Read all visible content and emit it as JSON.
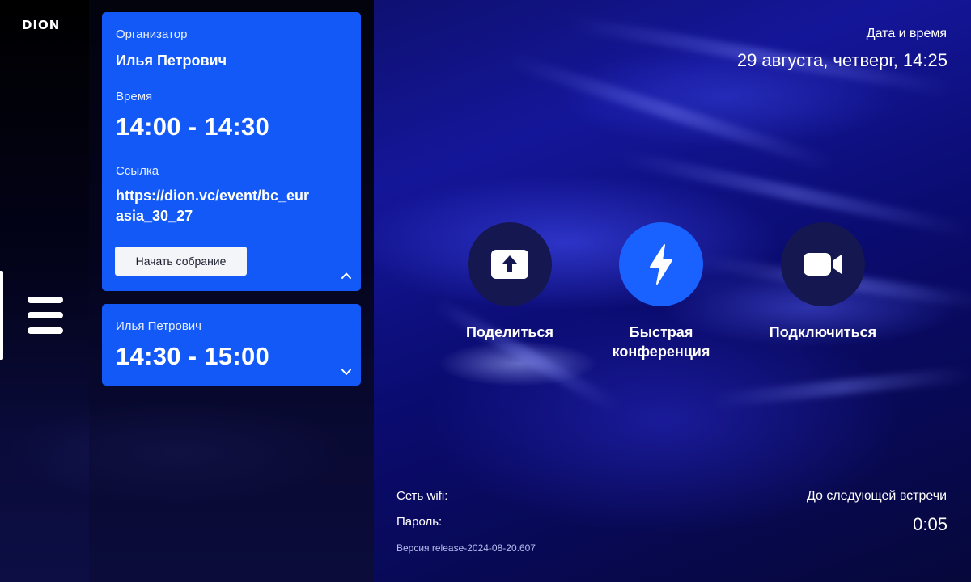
{
  "brand": {
    "logo_text": "DION"
  },
  "meetings": [
    {
      "organizer_label": "Организатор",
      "organizer": "Илья Петрович",
      "time_label": "Время",
      "time": "14:00 - 14:30",
      "link_label": "Ссылка",
      "link": "https://dion.vc/event/bc_eurasia_30_27",
      "start_label": "Начать собрание",
      "expanded": true
    },
    {
      "organizer": "Илья Петрович",
      "time": "14:30 - 15:00",
      "expanded": false
    }
  ],
  "datetime": {
    "label": "Дата и время",
    "value": "29 августа, четверг, 14:25"
  },
  "actions": {
    "share": "Поделиться",
    "quick": "Быстрая конференция",
    "connect": "Подключиться"
  },
  "network": {
    "wifi_label": "Сеть wifi:",
    "password_label": "Пароль:",
    "version": "Версия release-2024-08-20.607"
  },
  "next_meeting": {
    "label": "До следующей встречи",
    "value": "0:05"
  },
  "colors": {
    "card": "#1259f7",
    "accent_button": "#1a62ff",
    "dark_button": "#151750",
    "background": "#07083a"
  },
  "icons": {
    "share": "arrow-up-icon",
    "quick": "lightning-icon",
    "connect": "video-camera-icon",
    "menu": "hamburger-icon"
  }
}
